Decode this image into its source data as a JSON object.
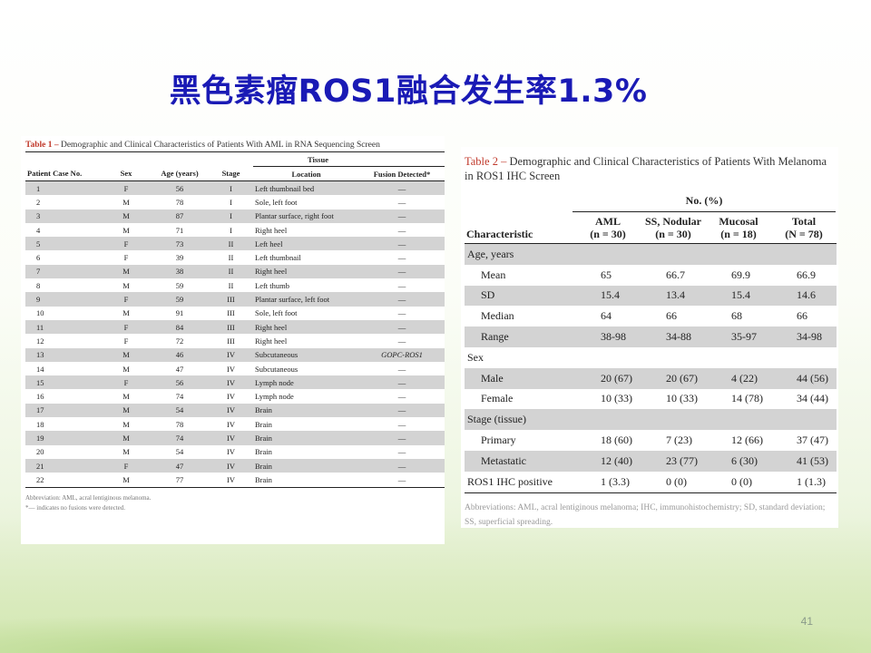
{
  "slide": {
    "title": "黑色素瘤ROS1融合发生率1.3%",
    "page_number": "41"
  },
  "table1": {
    "caption_label": "Table 1 –",
    "caption_text": " Demographic and Clinical Characteristics of Patients With AML in RNA Sequencing Screen",
    "tissue_header": "Tissue",
    "headers": [
      "Patient Case No.",
      "Sex",
      "Age (years)",
      "Stage",
      "Location",
      "Fusion Detected*"
    ],
    "rows": [
      [
        "1",
        "F",
        "56",
        "I",
        "Left thumbnail bed",
        "—"
      ],
      [
        "2",
        "M",
        "78",
        "I",
        "Sole, left foot",
        "—"
      ],
      [
        "3",
        "M",
        "87",
        "I",
        "Plantar surface, right foot",
        "—"
      ],
      [
        "4",
        "M",
        "71",
        "I",
        "Right heel",
        "—"
      ],
      [
        "5",
        "F",
        "73",
        "II",
        "Left heel",
        "—"
      ],
      [
        "6",
        "F",
        "39",
        "II",
        "Left thumbnail",
        "—"
      ],
      [
        "7",
        "M",
        "38",
        "II",
        "Right heel",
        "—"
      ],
      [
        "8",
        "M",
        "59",
        "II",
        "Left thumb",
        "—"
      ],
      [
        "9",
        "F",
        "59",
        "III",
        "Plantar surface, left foot",
        "—"
      ],
      [
        "10",
        "M",
        "91",
        "III",
        "Sole, left foot",
        "—"
      ],
      [
        "11",
        "F",
        "84",
        "III",
        "Right heel",
        "—"
      ],
      [
        "12",
        "F",
        "72",
        "III",
        "Right heel",
        "—"
      ],
      [
        "13",
        "M",
        "46",
        "IV",
        "Subcutaneous",
        "GOPC-ROS1"
      ],
      [
        "14",
        "M",
        "47",
        "IV",
        "Subcutaneous",
        "—"
      ],
      [
        "15",
        "F",
        "56",
        "IV",
        "Lymph node",
        "—"
      ],
      [
        "16",
        "M",
        "74",
        "IV",
        "Lymph node",
        "—"
      ],
      [
        "17",
        "M",
        "54",
        "IV",
        "Brain",
        "—"
      ],
      [
        "18",
        "M",
        "78",
        "IV",
        "Brain",
        "—"
      ],
      [
        "19",
        "M",
        "74",
        "IV",
        "Brain",
        "—"
      ],
      [
        "20",
        "M",
        "54",
        "IV",
        "Brain",
        "—"
      ],
      [
        "21",
        "F",
        "47",
        "IV",
        "Brain",
        "—"
      ],
      [
        "22",
        "M",
        "77",
        "IV",
        "Brain",
        "—"
      ]
    ],
    "footnote_1": "Abbreviation: AML, acral lentiginous melanoma.",
    "footnote_2": "*— indicates no fusions were detected."
  },
  "table2": {
    "caption_label": "Table 2 –",
    "caption_text": " Demographic and Clinical Characteristics of Patients With Melanoma in ROS1 IHC Screen",
    "group_header": "No. (%)",
    "headers": [
      {
        "l1": "",
        "l2": "Characteristic"
      },
      {
        "l1": "AML",
        "l2": "(n = 30)"
      },
      {
        "l1": "SS, Nodular",
        "l2": "(n = 30)"
      },
      {
        "l1": "Mucosal",
        "l2": "(n = 18)"
      },
      {
        "l1": "Total",
        "l2": "(N = 78)"
      }
    ],
    "rows": [
      {
        "label": "Age, years",
        "sub": false,
        "cells": [
          "",
          "",
          "",
          ""
        ]
      },
      {
        "label": "Mean",
        "sub": true,
        "cells": [
          "65",
          "66.7",
          "69.9",
          "66.9"
        ]
      },
      {
        "label": "SD",
        "sub": true,
        "cells": [
          "15.4",
          "13.4",
          "15.4",
          "14.6"
        ]
      },
      {
        "label": "Median",
        "sub": true,
        "cells": [
          "64",
          "66",
          "68",
          "66"
        ]
      },
      {
        "label": "Range",
        "sub": true,
        "cells": [
          "38-98",
          "34-88",
          "35-97",
          "34-98"
        ]
      },
      {
        "label": "Sex",
        "sub": false,
        "cells": [
          "",
          "",
          "",
          ""
        ]
      },
      {
        "label": "Male",
        "sub": true,
        "cells": [
          "20 (67)",
          "20 (67)",
          "4 (22)",
          "44 (56)"
        ]
      },
      {
        "label": "Female",
        "sub": true,
        "cells": [
          "10 (33)",
          "10 (33)",
          "14 (78)",
          "34 (44)"
        ]
      },
      {
        "label": "Stage (tissue)",
        "sub": false,
        "cells": [
          "",
          "",
          "",
          ""
        ]
      },
      {
        "label": "Primary",
        "sub": true,
        "cells": [
          "18 (60)",
          "7 (23)",
          "12 (66)",
          "37 (47)"
        ]
      },
      {
        "label": "Metastatic",
        "sub": true,
        "cells": [
          "12 (40)",
          "23 (77)",
          "6 (30)",
          "41 (53)"
        ]
      },
      {
        "label": "ROS1 IHC positive",
        "sub": false,
        "cells": [
          "1 (3.3)",
          "0 (0)",
          "0 (0)",
          "1 (1.3)"
        ]
      }
    ],
    "footnote": "Abbreviations: AML, acral lentiginous melanoma; IHC, immunohistochemistry; SD, standard deviation; SS, superficial spreading."
  }
}
